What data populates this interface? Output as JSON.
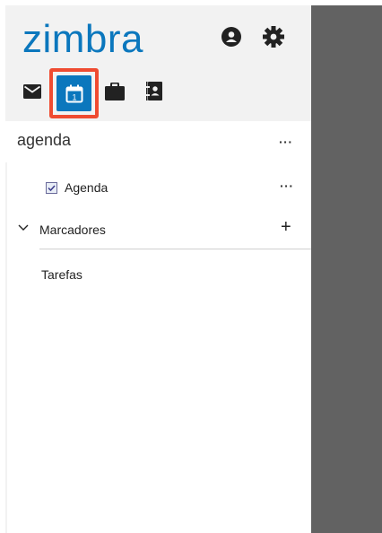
{
  "header": {
    "logo": "zimbra",
    "icons": [
      "profile-icon",
      "settings-icon"
    ],
    "apps": [
      {
        "name": "mail-icon"
      },
      {
        "name": "calendar-icon",
        "active": true,
        "day": "1"
      },
      {
        "name": "briefcase-icon"
      },
      {
        "name": "contacts-icon"
      }
    ]
  },
  "section": {
    "title": "agenda",
    "more": "···"
  },
  "folders": [
    {
      "label": "Agenda",
      "more": "···",
      "checked": true
    }
  ],
  "tags": {
    "label": "Marcadores",
    "add": "+"
  },
  "tasks": {
    "label": "Tarefas"
  },
  "colors": {
    "brand": "#0b77bd",
    "highlight": "#ef4b31",
    "overlay": "#626262"
  }
}
